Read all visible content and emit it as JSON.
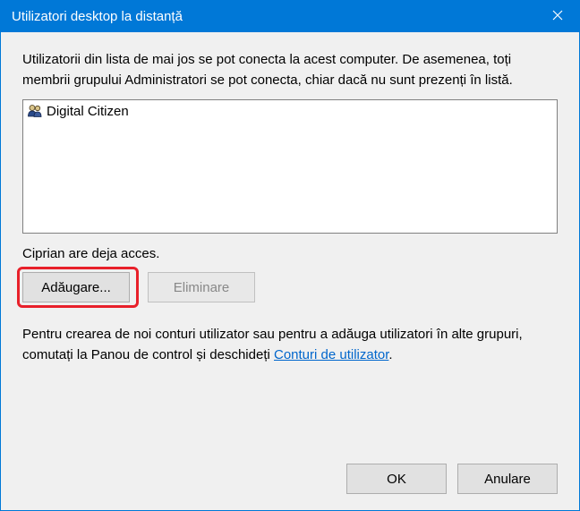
{
  "titlebar": {
    "title": "Utilizatori desktop la distanță"
  },
  "description": "Utilizatorii din lista de mai jos se pot conecta la acest computer. De asemenea, toți membrii grupului Administratori se pot conecta, chiar dacă nu sunt prezenți în listă.",
  "users": [
    {
      "name": "Digital Citizen"
    }
  ],
  "access_status": "Ciprian are deja acces.",
  "buttons": {
    "add": "Adăugare...",
    "remove": "Eliminare"
  },
  "help": {
    "prefix": "Pentru crearea de noi conturi utilizator sau pentru a adăuga utilizatori în alte grupuri, comutați la Panou de control și deschideți ",
    "link": "Conturi de utilizator",
    "suffix": "."
  },
  "footer": {
    "ok": "OK",
    "cancel": "Anulare"
  }
}
